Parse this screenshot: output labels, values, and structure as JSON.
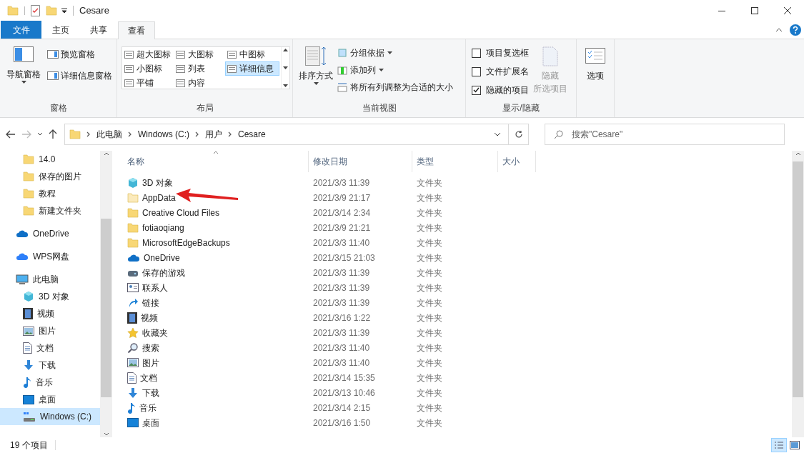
{
  "window": {
    "title": "Cesare"
  },
  "ribbon_tabs": [
    {
      "label": "文件",
      "kind": "file",
      "selected": false
    },
    {
      "label": "主页",
      "kind": "tab",
      "selected": false
    },
    {
      "label": "共享",
      "kind": "tab",
      "selected": false
    },
    {
      "label": "查看",
      "kind": "tab",
      "selected": true
    }
  ],
  "ribbon": {
    "panes": {
      "group": "窗格",
      "nav": "导航窗格",
      "preview": "预览窗格",
      "details": "详细信息窗格"
    },
    "layout": {
      "group": "布局",
      "options": [
        {
          "label": "超大图标",
          "selected": false
        },
        {
          "label": "大图标",
          "selected": false
        },
        {
          "label": "中图标",
          "selected": false
        },
        {
          "label": "小图标",
          "selected": false
        },
        {
          "label": "列表",
          "selected": false
        },
        {
          "label": "详细信息",
          "selected": true
        },
        {
          "label": "平铺",
          "selected": false
        },
        {
          "label": "内容",
          "selected": false
        }
      ]
    },
    "current_view": {
      "group": "当前视图",
      "sort": "排序方式",
      "group_by": "分组依据",
      "add_column": "添加列",
      "fit": "将所有列调整为合适的大小"
    },
    "show_hide": {
      "group": "显示/隐藏",
      "options": [
        {
          "label": "项目复选框",
          "checked": false
        },
        {
          "label": "文件扩展名",
          "checked": false
        },
        {
          "label": "隐藏的项目",
          "checked": true
        }
      ],
      "hide_selected": [
        "隐藏",
        "所选项目"
      ]
    },
    "options": "选项"
  },
  "address": {
    "path": [
      "此电脑",
      "Windows (C:)",
      "用户",
      "Cesare"
    ]
  },
  "search": {
    "placeholder": "搜索\"Cesare\""
  },
  "sidebar": [
    {
      "children": [
        {
          "label": "14.0",
          "kind": "folder",
          "selected": false
        },
        {
          "label": "保存的图片",
          "kind": "folder",
          "selected": false
        },
        {
          "label": "教程",
          "kind": "folder",
          "selected": false
        },
        {
          "label": "新建文件夹",
          "kind": "folder",
          "selected": false
        }
      ]
    },
    {
      "label": "OneDrive",
      "kind": "onedrive",
      "selected": false
    },
    {
      "label": "WPS网盘",
      "kind": "cloud",
      "selected": false
    },
    {
      "label": "此电脑",
      "kind": "pc",
      "selected": false,
      "children": [
        {
          "label": "3D 对象",
          "kind": "cube",
          "selected": false
        },
        {
          "label": "视频",
          "kind": "video",
          "selected": false
        },
        {
          "label": "图片",
          "kind": "picture",
          "selected": false
        },
        {
          "label": "文档",
          "kind": "doc",
          "selected": false
        },
        {
          "label": "下载",
          "kind": "download",
          "selected": false
        },
        {
          "label": "音乐",
          "kind": "music",
          "selected": false
        },
        {
          "label": "桌面",
          "kind": "desktop",
          "selected": false
        },
        {
          "label": "Windows (C:)",
          "kind": "drive",
          "selected": true
        }
      ]
    }
  ],
  "table": {
    "columns": [
      "名称",
      "修改日期",
      "类型",
      "大小"
    ],
    "rows": [
      {
        "name": "3D 对象",
        "kind": "cube",
        "date": "2021/3/3 11:39",
        "type": "文件夹"
      },
      {
        "name": "AppData",
        "kind": "hidden",
        "date": "2021/3/9 21:17",
        "type": "文件夹"
      },
      {
        "name": "Creative Cloud Files",
        "kind": "folder",
        "date": "2021/3/14 2:34",
        "type": "文件夹"
      },
      {
        "name": "fotiaoqiang",
        "kind": "folder",
        "date": "2021/3/9 21:21",
        "type": "文件夹"
      },
      {
        "name": "MicrosoftEdgeBackups",
        "kind": "folder",
        "date": "2021/3/3 11:40",
        "type": "文件夹"
      },
      {
        "name": "OneDrive",
        "kind": "onedrive",
        "date": "2021/3/15 21:03",
        "type": "文件夹"
      },
      {
        "name": "保存的游戏",
        "kind": "games",
        "date": "2021/3/3 11:39",
        "type": "文件夹"
      },
      {
        "name": "联系人",
        "kind": "contacts",
        "date": "2021/3/3 11:39",
        "type": "文件夹"
      },
      {
        "name": "链接",
        "kind": "link",
        "date": "2021/3/3 11:39",
        "type": "文件夹"
      },
      {
        "name": "视频",
        "kind": "video",
        "date": "2021/3/16 1:22",
        "type": "文件夹"
      },
      {
        "name": "收藏夹",
        "kind": "star",
        "date": "2021/3/3 11:39",
        "type": "文件夹"
      },
      {
        "name": "搜索",
        "kind": "search",
        "date": "2021/3/3 11:40",
        "type": "文件夹"
      },
      {
        "name": "图片",
        "kind": "picture",
        "date": "2021/3/3 11:40",
        "type": "文件夹"
      },
      {
        "name": "文档",
        "kind": "doc",
        "date": "2021/3/14 15:35",
        "type": "文件夹"
      },
      {
        "name": "下载",
        "kind": "download",
        "date": "2021/3/13 10:46",
        "type": "文件夹"
      },
      {
        "name": "音乐",
        "kind": "music",
        "date": "2021/3/14 2:15",
        "type": "文件夹"
      },
      {
        "name": "桌面",
        "kind": "desktop",
        "date": "2021/3/16 1:50",
        "type": "文件夹"
      }
    ]
  },
  "status_bar": {
    "count": "19 个项目"
  }
}
